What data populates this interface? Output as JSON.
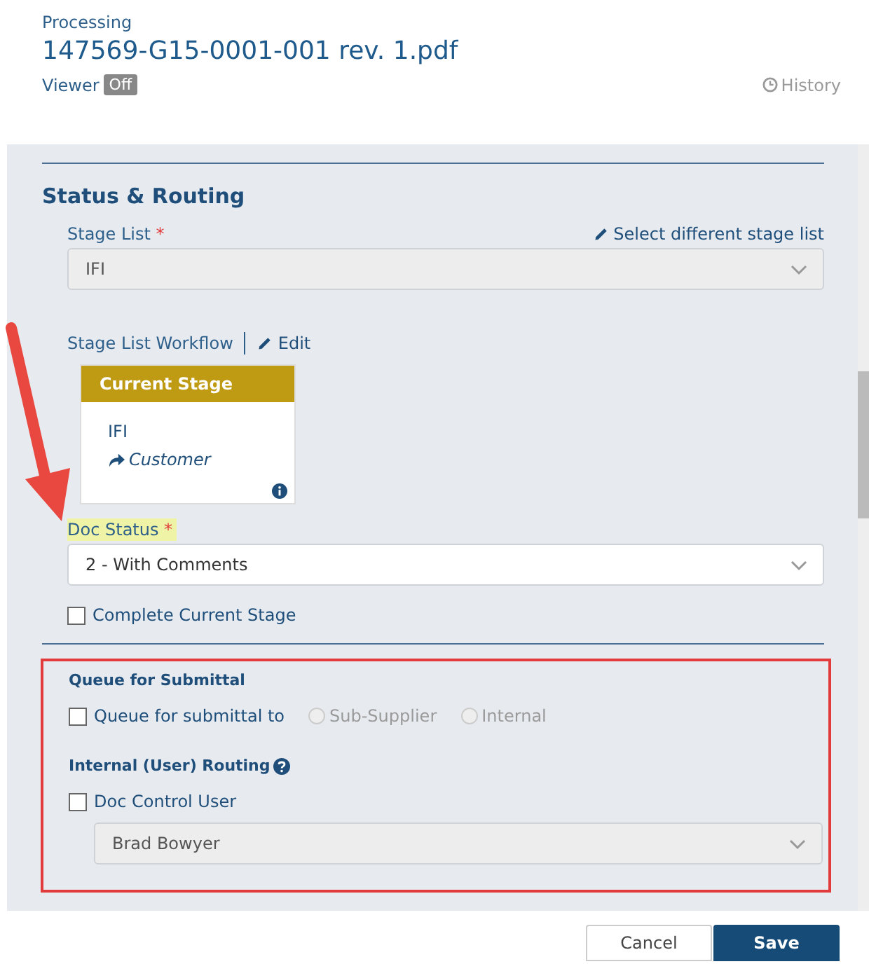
{
  "header": {
    "status": "Processing",
    "title": "147569-G15-0001-001 rev. 1.pdf",
    "viewer": {
      "label": "Viewer",
      "toggle": "Off",
      "on": false
    },
    "history": "History"
  },
  "section": {
    "title": "Status & Routing",
    "stage_list": {
      "label": "Stage List",
      "required_mark": "*",
      "link": "Select different stage list",
      "value": "IFI",
      "disabled": true
    },
    "workflow": {
      "label": "Stage List Workflow",
      "edit": "Edit",
      "card": {
        "header": "Current Stage",
        "stage": "IFI",
        "target": "Customer"
      }
    },
    "doc_status": {
      "label": "Doc Status",
      "required_mark": "*",
      "highlighted": true,
      "value": "2 - With Comments",
      "disabled": false
    },
    "complete": {
      "label": "Complete Current Stage",
      "checked": false
    }
  },
  "submittal": {
    "title": "Queue for Submittal",
    "outlined": true,
    "queue": {
      "label": "Queue for submittal to",
      "checked": false,
      "options": [
        {
          "label": "Sub-Supplier",
          "selected": false,
          "disabled": true
        },
        {
          "label": "Internal",
          "selected": false,
          "disabled": true
        }
      ]
    },
    "routing": {
      "title": "Internal (User) Routing",
      "user": {
        "label": "Doc Control User",
        "checked": false,
        "value": "Brad Bowyer",
        "disabled": true
      }
    }
  },
  "buttons": [
    {
      "label": "Cancel",
      "kind": "secondary"
    },
    {
      "label": "Save",
      "kind": "primary"
    }
  ]
}
